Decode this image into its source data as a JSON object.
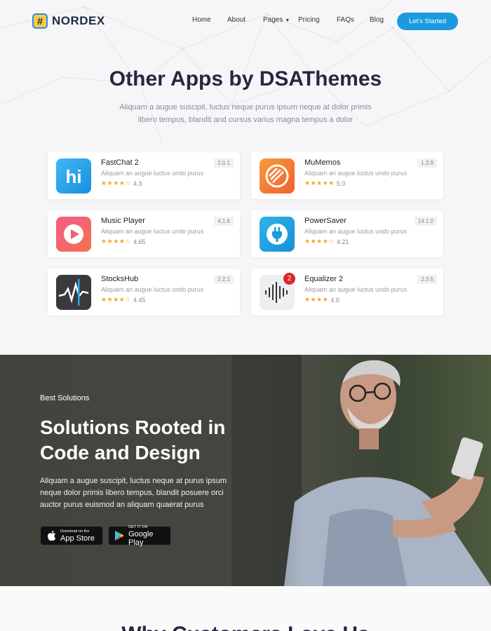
{
  "brand": {
    "name": "NORDEX",
    "mark": "#"
  },
  "nav": {
    "items": [
      "Home",
      "About",
      "Pages",
      "Pricing",
      "FAQs",
      "Blog"
    ],
    "cta": "Let's Started"
  },
  "apps_section": {
    "title": "Other Apps by DSAThemes",
    "subtitle": "Aliquam a augue suscipit, luctus neque purus ipsum neque at dolor primis libero tempus, blandit and cursus varius magna tempus a dolor",
    "apps": [
      {
        "name": "FastChat 2",
        "desc": "Aliquam an augue luctus undo purus",
        "rating": "4.3",
        "stars": "★★★★☆",
        "version": "2.0.1",
        "icon": "fastchat-icon"
      },
      {
        "name": "MuMemos",
        "desc": "Aliquam an augue luctus undo purus",
        "rating": "5.0",
        "stars": "★★★★★",
        "version": "1.3.9",
        "icon": "mumemos-icon"
      },
      {
        "name": "Music Player",
        "desc": "Aliquam an augue luctus undo purus",
        "rating": "4.65",
        "stars": "★★★★☆",
        "version": "4.1.6",
        "icon": "music-player-icon"
      },
      {
        "name": "PowerSaver",
        "desc": "Aliquam an augue luctus undo purus",
        "rating": "4.21",
        "stars": "★★★★☆",
        "version": "14.1.0",
        "icon": "powersaver-icon"
      },
      {
        "name": "StocksHub",
        "desc": "Aliquam an augue luctus undo purus",
        "rating": "4.45",
        "stars": "★★★★☆",
        "version": "2.2.1",
        "icon": "stockshub-icon"
      },
      {
        "name": "Equalizer 2",
        "desc": "Aliquam an augue luctus undo purus",
        "rating": "4.0",
        "stars": "★★★★",
        "version": "2.3.5",
        "icon": "equalizer-icon",
        "badge": "2"
      }
    ]
  },
  "hero": {
    "kicker": "Best Solutions",
    "title": "Solutions Rooted in Code and Design",
    "text": "Aliquam a augue suscipit, luctus neque at purus ipsum neque dolor primis libero tempus, blandit posuere orci auctor purus euismod an aliquam quaerat purus",
    "appstore": {
      "small": "Download on the",
      "big": "App Store"
    },
    "googleplay": {
      "small": "GET IT ON",
      "big": "Google Play"
    }
  },
  "bottom": {
    "title": "Why Customers Love Us"
  },
  "colors": {
    "accent": "#1a9ae0",
    "star": "#f5a623",
    "heading": "#2b2540"
  }
}
